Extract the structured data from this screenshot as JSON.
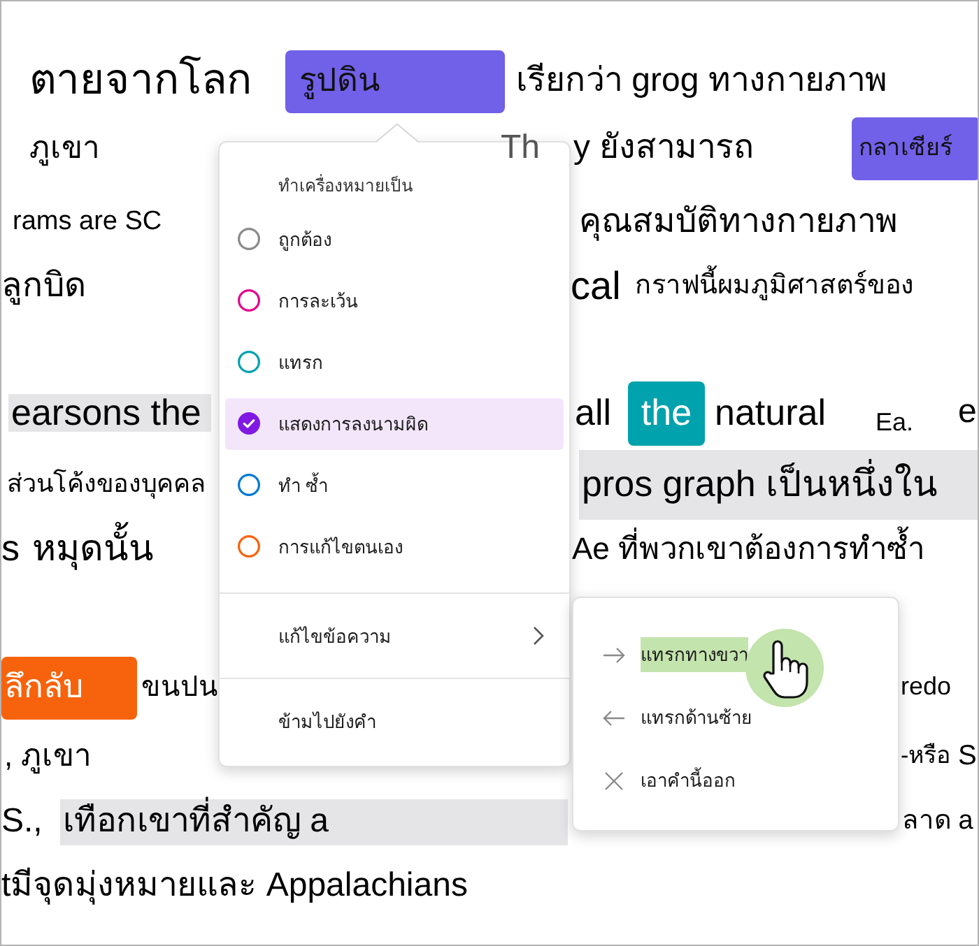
{
  "document": {
    "lines": [
      {
        "fragments": [
          {
            "kind": "plain",
            "text": "ตายจากโลก"
          },
          {
            "kind": "badge",
            "text": "รูปดิน",
            "color": "#7160e8"
          },
          {
            "kind": "plain",
            "text": "เรียกว่า grog ทางกายภาพ"
          }
        ]
      },
      {
        "fragments": [
          {
            "kind": "plain",
            "text": "ภูเขา"
          },
          {
            "kind": "plain",
            "text": "Th"
          },
          {
            "kind": "plain",
            "text": "y ยังสามารถ"
          },
          {
            "kind": "badge",
            "text": "กลาเซียร์",
            "color": "#7160e8"
          }
        ]
      },
      {
        "fragments": [
          {
            "kind": "plain",
            "text": "rams are SC"
          },
          {
            "kind": "plain",
            "text": "คุณสมบัติทางกายภาพ"
          }
        ]
      },
      {
        "fragments": [
          {
            "kind": "plain",
            "text": "ลูกบิด"
          },
          {
            "kind": "plain",
            "text": "cal"
          },
          {
            "kind": "plain",
            "text": "กราฟนี้ผมภูมิศาสตร์ของ"
          }
        ]
      },
      {
        "fragments": [
          {
            "kind": "shaded",
            "text": "earsons the"
          },
          {
            "kind": "plain",
            "text": "all"
          },
          {
            "kind": "badge",
            "text": "the",
            "color": "#00a2ad"
          },
          {
            "kind": "plain",
            "text": "natural"
          },
          {
            "kind": "plain",
            "text": "Ea."
          },
          {
            "kind": "plain",
            "text": "e"
          }
        ]
      },
      {
        "fragments": [
          {
            "kind": "plain",
            "text": "ส่วนโค้งของบุคคล"
          },
          {
            "kind": "shaded",
            "text": "pros graph เป็นหนึ่งใน"
          }
        ]
      },
      {
        "fragments": [
          {
            "kind": "plain",
            "text": "s"
          },
          {
            "kind": "plain",
            "text": "หมุดนั้น"
          },
          {
            "kind": "plain",
            "text": "Ae ที่พวกเขาต้องการทำซ้ำ"
          }
        ]
      },
      {
        "fragments": [
          {
            "kind": "badge",
            "text": "ลึกลับ",
            "color": "#f7630c"
          },
          {
            "kind": "plain",
            "text": "ขนปน"
          },
          {
            "kind": "plain",
            "text": "redo"
          }
        ]
      },
      {
        "fragments": [
          {
            "kind": "plain",
            "text": ", ภูเขา"
          },
          {
            "kind": "plain",
            "text": "-หรือ"
          },
          {
            "kind": "plain",
            "text": "S"
          }
        ]
      },
      {
        "fragments": [
          {
            "kind": "plain",
            "text": "S.,"
          },
          {
            "kind": "shaded",
            "text": "เทือกเขาที่สำคัญ a"
          },
          {
            "kind": "plain",
            "text": "ลาด a"
          }
        ]
      },
      {
        "fragments": [
          {
            "kind": "plain",
            "text": "tมีจุดมุ่งหมายและ Appalachians"
          }
        ]
      }
    ]
  },
  "mark_menu": {
    "heading": "ทำเครื่องหมายเป็น",
    "options": [
      {
        "label": "ถูกต้อง",
        "color": "#8a8a8a",
        "selected": false
      },
      {
        "label": "การละเว้น",
        "color": "#e3008c",
        "selected": false
      },
      {
        "label": "แทรก",
        "color": "#00a2ad",
        "selected": false
      },
      {
        "label": "แสดงการลงนามผิด",
        "color": "#8019e3",
        "selected": true
      },
      {
        "label": "ทำ ซ้ำ",
        "color": "#0078d4",
        "selected": false
      },
      {
        "label": "การแก้ไขตนเอง",
        "color": "#f7630c",
        "selected": false
      }
    ],
    "actions": [
      {
        "label": "แก้ไขข้อความ",
        "kind": "submenu"
      },
      {
        "label": "ข้ามไปยังคำ",
        "kind": "action"
      }
    ]
  },
  "edit_submenu": {
    "items": [
      {
        "label": "แทรกทางขวา",
        "kind": "insert-right",
        "highlighted": true
      },
      {
        "label": "แทรกด้านซ้าย",
        "kind": "insert-left",
        "highlighted": false
      },
      {
        "label": "เอาคำนี้ออก",
        "kind": "remove",
        "highlighted": false
      }
    ]
  }
}
